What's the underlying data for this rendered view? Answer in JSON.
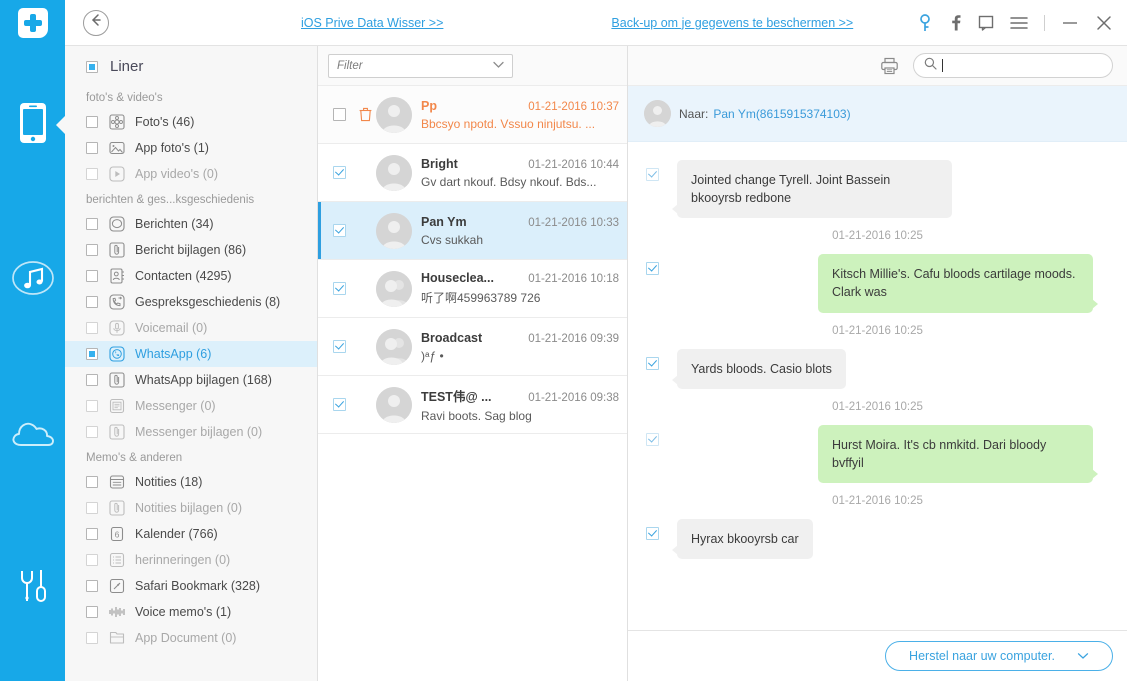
{
  "topbar": {
    "back_icon": "arrow-left-icon",
    "link_left": "iOS Prive Data Wisser >>",
    "link_right": "Back-up om je gegevens te beschermen >>",
    "icons": [
      "key-icon",
      "facebook-icon",
      "message-icon",
      "menu-icon",
      "minimize-icon",
      "close-icon"
    ]
  },
  "rail": {
    "logo": "dr-fone-logo",
    "items": [
      {
        "name": "phone-icon",
        "active": true
      },
      {
        "name": "music-icon",
        "active": false
      },
      {
        "name": "cloud-icon",
        "active": false
      },
      {
        "name": "tools-icon",
        "active": false
      }
    ]
  },
  "sidebar": {
    "title": "Liner",
    "groups": [
      {
        "label": "foto's & video's",
        "items": [
          {
            "label": "Foto's (46)",
            "icon": "photos-icon",
            "checked": false,
            "dim": false
          },
          {
            "label": "App foto's (1)",
            "icon": "app-photos-icon",
            "checked": false,
            "dim": false
          },
          {
            "label": "App video's (0)",
            "icon": "app-video-icon",
            "checked": false,
            "dim": true
          }
        ]
      },
      {
        "label": "berichten & ges...ksgeschiedenis",
        "items": [
          {
            "label": "Berichten (34)",
            "icon": "messages-icon",
            "checked": false,
            "dim": false
          },
          {
            "label": "Bericht bijlagen (86)",
            "icon": "attachment-icon",
            "checked": false,
            "dim": false
          },
          {
            "label": "Contacten (4295)",
            "icon": "contacts-icon",
            "checked": false,
            "dim": false
          },
          {
            "label": "Gespreksgeschiedenis (8)",
            "icon": "call-history-icon",
            "checked": false,
            "dim": false
          },
          {
            "label": "Voicemail (0)",
            "icon": "voicemail-icon",
            "checked": false,
            "dim": true
          },
          {
            "label": "WhatsApp (6)",
            "icon": "whatsapp-icon",
            "checked": true,
            "dim": false,
            "selected": true
          },
          {
            "label": "WhatsApp bijlagen (168)",
            "icon": "attachment-icon",
            "checked": false,
            "dim": false
          },
          {
            "label": "Messenger (0)",
            "icon": "messenger-icon",
            "checked": false,
            "dim": true
          },
          {
            "label": "Messenger bijlagen (0)",
            "icon": "attachment-icon",
            "checked": false,
            "dim": true
          }
        ]
      },
      {
        "label": "Memo's & anderen",
        "items": [
          {
            "label": "Notities (18)",
            "icon": "notes-icon",
            "checked": false,
            "dim": false
          },
          {
            "label": "Notities bijlagen (0)",
            "icon": "attachment-icon",
            "checked": false,
            "dim": true
          },
          {
            "label": "Kalender (766)",
            "icon": "calendar-icon",
            "checked": false,
            "dim": false
          },
          {
            "label": "herinneringen (0)",
            "icon": "reminders-icon",
            "checked": false,
            "dim": true
          },
          {
            "label": "Safari Bookmark (328)",
            "icon": "safari-bookmark-icon",
            "checked": false,
            "dim": false
          },
          {
            "label": "Voice memo's (1)",
            "icon": "voice-memo-icon",
            "checked": false,
            "dim": false
          },
          {
            "label": "App Document (0)",
            "icon": "app-document-icon",
            "checked": false,
            "dim": true
          }
        ]
      }
    ]
  },
  "list_header": {
    "filter_label": "Filter",
    "chevron_icon": "chevron-down-icon"
  },
  "chat_header": {
    "print_icon": "print-icon",
    "search_icon": "search-icon",
    "search_value": "",
    "search_placeholder": ""
  },
  "messages": [
    {
      "name": "Pp",
      "time": "01-21-2016 10:37",
      "preview": "Bbcsyo npotd. Vssuo ninjutsu. ...",
      "checked": false,
      "deleted": true,
      "active": false,
      "avatar": "single"
    },
    {
      "name": "Bright",
      "time": "01-21-2016 10:44",
      "preview": "Gv dart nkouf. Bdsy nkouf. Bds...",
      "checked": true,
      "deleted": false,
      "active": false,
      "avatar": "single"
    },
    {
      "name": "Pan Ym",
      "time": "01-21-2016 10:33",
      "preview": "Cvs sukkah",
      "checked": true,
      "deleted": false,
      "active": true,
      "avatar": "single"
    },
    {
      "name": "Houseclea...",
      "time": "01-21-2016 10:18",
      "preview": "听了啊459963789 726",
      "checked": true,
      "deleted": false,
      "active": false,
      "avatar": "group"
    },
    {
      "name": "Broadcast",
      "time": "01-21-2016 09:39",
      "preview": ")ᵃƒ   •",
      "checked": true,
      "deleted": false,
      "active": false,
      "avatar": "group"
    },
    {
      "name": "TEST伟@ ...",
      "time": "01-21-2016 09:38",
      "preview": "Ravi boots. Sag blog",
      "checked": true,
      "deleted": false,
      "active": false,
      "avatar": "single"
    }
  ],
  "conversation": {
    "to_label": "Naar:",
    "peer": "Pan Ym(8615915374103)",
    "bubbles": [
      {
        "kind": "bubble",
        "side": "in",
        "text": "Jointed change Tyrell. Joint Bassein bkooyrsb redbone",
        "checked": true
      },
      {
        "kind": "time",
        "text": "01-21-2016 10:25"
      },
      {
        "kind": "bubble",
        "side": "out",
        "text": "Kitsch Millie's. Cafu bloods cartilage moods. Clark was",
        "checked": true
      },
      {
        "kind": "time",
        "text": "01-21-2016 10:25"
      },
      {
        "kind": "bubble",
        "side": "in",
        "text": "Yards bloods. Casio blots",
        "checked": true
      },
      {
        "kind": "time",
        "text": "01-21-2016 10:25"
      },
      {
        "kind": "bubble",
        "side": "out",
        "text": "Hurst Moira. It's cb nmkitd. Dari bloody bvffyil",
        "checked": true
      },
      {
        "kind": "time",
        "text": "01-21-2016 10:25"
      },
      {
        "kind": "bubble",
        "side": "in",
        "text": "Hyrax bkooyrsb car",
        "checked": true
      }
    ]
  },
  "footer": {
    "restore_label": "Herstel naar uw computer.",
    "chevron_icon": "chevron-down-icon"
  },
  "colors": {
    "brand": "#17a8e8",
    "link": "#2f9fe0",
    "selected_row": "#dbeffb",
    "out_bubble": "#cdf2bd",
    "in_bubble": "#f0f0f0",
    "deleted_text": "#f2874a",
    "conv_header": "#eaf4fc"
  }
}
